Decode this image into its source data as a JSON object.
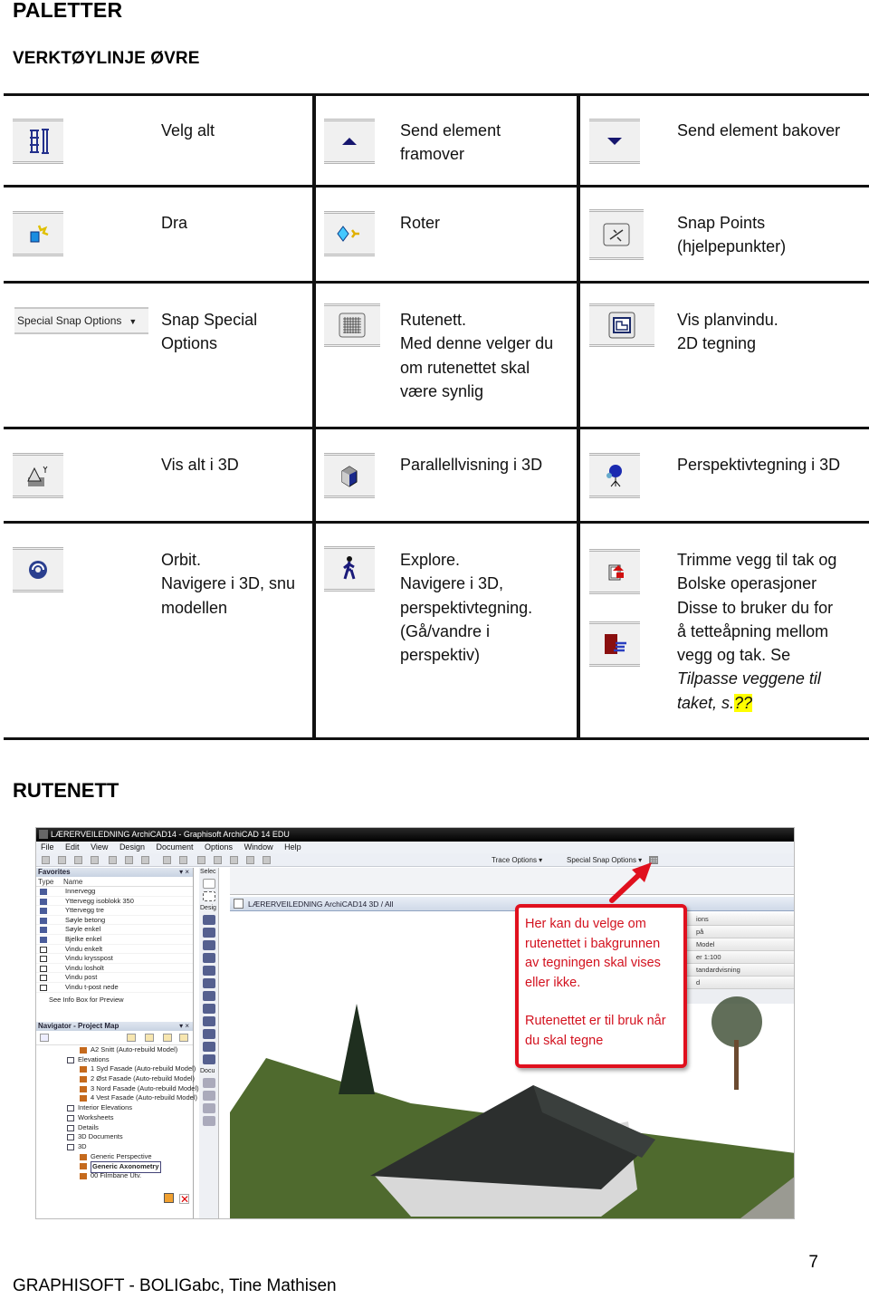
{
  "page": {
    "title": "PALETTER",
    "subtitle": "VERKTØYLINJE ØVRE",
    "section2_title": "RUTENETT",
    "footer_left": "GRAPHISOFT - BOLIGabc, Tine Mathisen",
    "page_number": "7"
  },
  "tools_table": {
    "rows": [
      [
        {
          "icon": "select-all-icon",
          "lines": [
            "Velg alt"
          ]
        },
        {
          "icon": "bring-forward-icon",
          "lines": [
            "Send element",
            "framover"
          ]
        },
        {
          "icon": "send-backward-icon",
          "lines": [
            "Send element bakover"
          ]
        }
      ],
      [
        {
          "icon": "drag-icon",
          "lines": [
            "Dra"
          ]
        },
        {
          "icon": "rotate-icon",
          "lines": [
            "Roter"
          ]
        },
        {
          "icon": "snap-points-icon",
          "lines": [
            "Snap Points",
            "(hjelpepunkter)"
          ]
        }
      ],
      [
        {
          "icon": "special-snap-options-dropdown",
          "icon_label": "Special Snap Options",
          "lines": [
            "Snap Special",
            "Options"
          ]
        },
        {
          "icon": "grid-icon",
          "lines": [
            "Rutenett.",
            "Med denne velger du",
            "om rutenettet skal",
            "være synlig"
          ]
        },
        {
          "icon": "floor-plan-window-icon",
          "lines": [
            "Vis planvindu.",
            "2D tegning"
          ]
        }
      ],
      [
        {
          "icon": "show-all-3d-icon",
          "lines": [
            "Vis alt i 3D"
          ]
        },
        {
          "icon": "parallel-view-icon",
          "lines": [
            "Parallellvisning i 3D"
          ]
        },
        {
          "icon": "perspective-camera-icon",
          "lines": [
            "Perspektivtegning i 3D"
          ]
        }
      ],
      [
        {
          "icon": "orbit-icon",
          "lines": [
            "Orbit.",
            "Navigere i 3D, snu",
            "modellen"
          ]
        },
        {
          "icon": "explore-walk-icon",
          "lines": [
            "Explore.",
            "Navigere i 3D,",
            "perspektivtegning.",
            "(Gå/vandre i",
            "perspektiv)"
          ]
        },
        {
          "icon": "trim-wall-to-roof-icon",
          "icon2": "boolean-operations-icon",
          "lines": [
            "Trimme vegg til tak og",
            "Bolske operasjoner",
            "Disse to bruker du for",
            "å tetteåpning mellom",
            "vegg og tak. Se"
          ],
          "italic_lines": [
            "Tilpasse veggene til",
            "taket, s."
          ],
          "highlight": "??"
        }
      ]
    ]
  },
  "screenshot": {
    "window_title": "LÆRERVEILEDNING ArchiCAD14 - Graphisoft ArchiCAD 14 EDU",
    "menu": [
      "File",
      "Edit",
      "View",
      "Design",
      "Document",
      "Options",
      "Window",
      "Help"
    ],
    "toolbar_labels": {
      "trace": "Trace Options ▾",
      "special_snap": "Special Snap Options ▾"
    },
    "favorites": {
      "title": "Favorites",
      "col_type": "Type",
      "col_name": "Name",
      "items": [
        "Innervegg",
        "Yttervegg isoblokk 350",
        "Yttervegg tre",
        "Søyle betong",
        "Søyle enkel",
        "Bjelke enkel",
        "Vindu enkelt",
        "Vindu krysspost",
        "Vindu losholt",
        "Vindu post",
        "Vindu t-post nede"
      ],
      "info": "See Info Box for Preview"
    },
    "navigator": {
      "title": "Navigator - Project Map",
      "items": [
        {
          "label": "A2 Snitt (Auto-rebuild Model)",
          "indent": 3
        },
        {
          "label": "Elevations",
          "indent": 2,
          "folder": true
        },
        {
          "label": "1 Syd Fasade (Auto-rebuild Model)",
          "indent": 3
        },
        {
          "label": "2 Øst Fasade (Auto-rebuild Model)",
          "indent": 3
        },
        {
          "label": "3 Nord Fasade (Auto-rebuild Model)",
          "indent": 3
        },
        {
          "label": "4 Vest Fasade (Auto-rebuild Model)",
          "indent": 3
        },
        {
          "label": "Interior Elevations",
          "indent": 2,
          "folder": true
        },
        {
          "label": "Worksheets",
          "indent": 2,
          "folder": true
        },
        {
          "label": "Details",
          "indent": 2,
          "folder": true
        },
        {
          "label": "3D Documents",
          "indent": 2,
          "folder": true
        },
        {
          "label": "3D",
          "indent": 2,
          "folder": true
        },
        {
          "label": "Generic Perspective",
          "indent": 3
        },
        {
          "label": "Generic Axonometry",
          "indent": 3,
          "selected": true
        },
        {
          "label": "00 Filmbane Utv.",
          "indent": 3
        }
      ]
    },
    "toolbox_labels": {
      "select": "Selec",
      "design": "Desig",
      "document": "Docu"
    },
    "view_tab": "LÆRERVEILEDNING ArchiCAD14 3D / All",
    "info_panel": [
      "ions",
      "på",
      "",
      "Model",
      "er 1:100",
      "tandardvisning",
      "d"
    ],
    "callout": {
      "para1": "Her kan du velge om rutenettet i bakgrunnen av tegningen skal vises eller ikke.",
      "para2": "Rutenettet er til bruk når du skal tegne",
      "color": "#e0101e"
    }
  }
}
